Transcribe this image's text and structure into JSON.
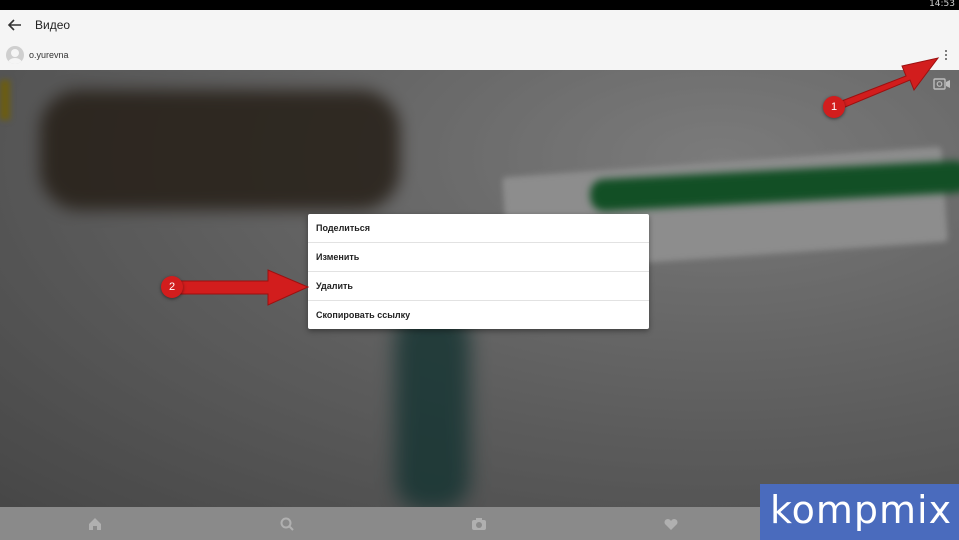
{
  "status_bar": {
    "time": "14:53"
  },
  "app_bar": {
    "title": "Видео",
    "back_icon": "arrow-left-icon"
  },
  "post_header": {
    "username": "o.yurevna",
    "more_icon": "more-vertical-icon"
  },
  "context_menu": {
    "items": [
      {
        "label": "Поделиться"
      },
      {
        "label": "Изменить"
      },
      {
        "label": "Удалить"
      },
      {
        "label": "Скопировать ссылку"
      }
    ]
  },
  "annotations": {
    "step1": "1",
    "step2": "2",
    "color": "#d21d1d"
  },
  "bottom_nav": {
    "icons": [
      "home-icon",
      "search-icon",
      "camera-icon",
      "heart-icon",
      "profile-icon"
    ]
  },
  "watermark": {
    "text": "kompmix"
  }
}
